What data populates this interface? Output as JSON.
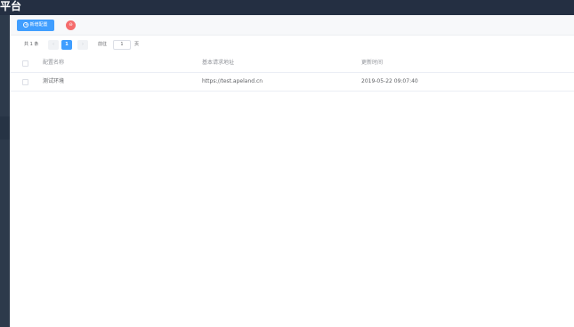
{
  "app": {
    "title": "平台"
  },
  "toolbar": {
    "add_label": "新增配置",
    "add_icon": "plus-circle-icon",
    "delete_icon": "delete-icon",
    "delete_color": "#f56c6c",
    "accent": "#409eff"
  },
  "pager": {
    "total_text": "共 1 条",
    "prev_icon": "chevron-left-icon",
    "current_page": "1",
    "next_icon": "chevron-right-icon",
    "goto_label": "前往",
    "goto_value": "1",
    "goto_unit": "页"
  },
  "table": {
    "columns": [
      "配置名称",
      "基本请求地址",
      "更新时间"
    ],
    "rows": [
      {
        "name": "测试环境",
        "url": "https://test.apeland.cn",
        "updated": "2019-05-22 09:07:40"
      }
    ]
  }
}
